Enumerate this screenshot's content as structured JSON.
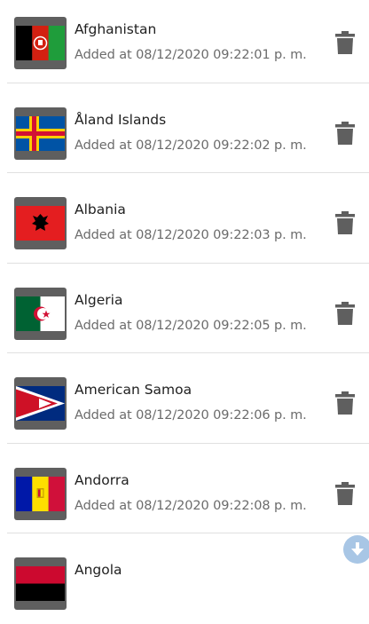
{
  "colors": {
    "text": "#212121",
    "subtext": "#6b6b6b",
    "icon": "#5f5f5f",
    "fab": "#9fc0e3"
  },
  "countries": [
    {
      "name": "Afghanistan",
      "added": "Added at 08/12/2020 09:22:01 p. m.",
      "flag": "afghanistan-flag"
    },
    {
      "name": "Åland Islands",
      "added": "Added at 08/12/2020 09:22:02 p. m.",
      "flag": "aland-islands-flag"
    },
    {
      "name": "Albania",
      "added": "Added at 08/12/2020 09:22:03 p. m.",
      "flag": "albania-flag"
    },
    {
      "name": "Algeria",
      "added": "Added at 08/12/2020 09:22:05 p. m.",
      "flag": "algeria-flag"
    },
    {
      "name": "American Samoa",
      "added": "Added at 08/12/2020 09:22:06 p. m.",
      "flag": "american-samoa-flag"
    },
    {
      "name": "Andorra",
      "added": "Added at 08/12/2020 09:22:08 p. m.",
      "flag": "andorra-flag"
    },
    {
      "name": "Angola",
      "added": "",
      "flag": "angola-flag"
    }
  ],
  "icons": {
    "delete": "trash-icon",
    "scroll": "arrow-down-icon"
  }
}
